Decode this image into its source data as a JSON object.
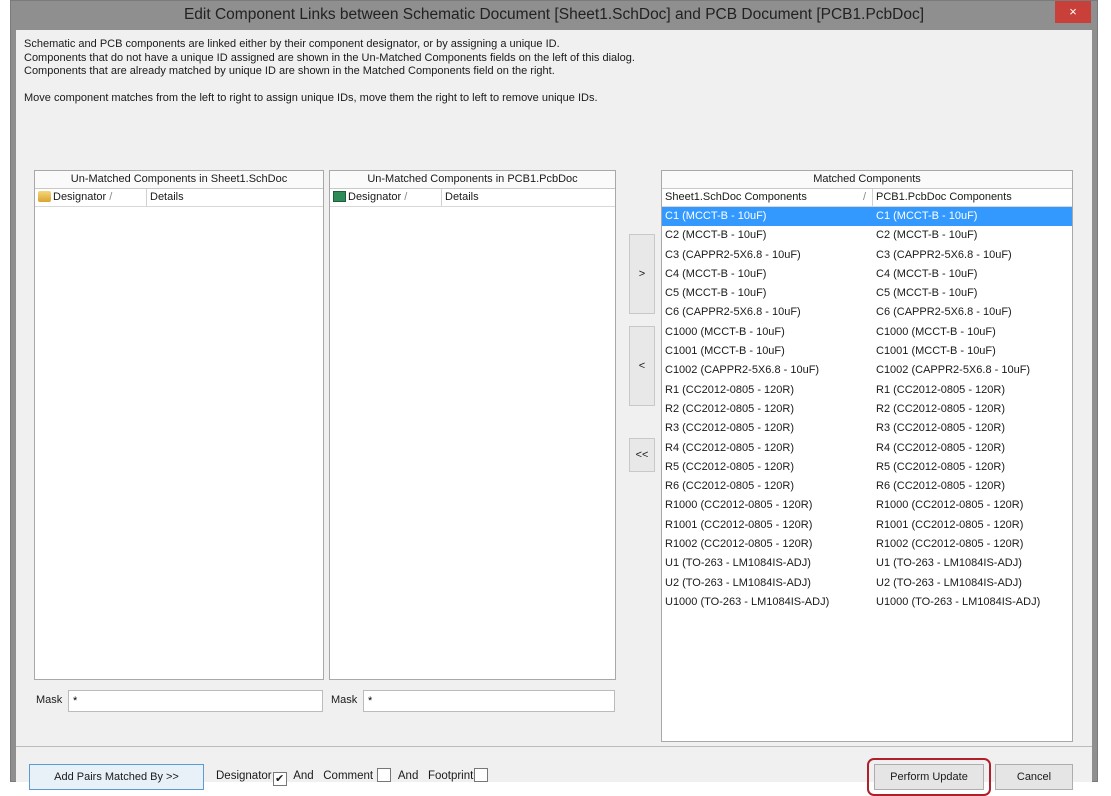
{
  "title": "Edit Component Links between Schematic Document [Sheet1.SchDoc] and PCB Document [PCB1.PcbDoc]",
  "close_label": "×",
  "intro": [
    "Schematic and PCB components are linked either by their component designator, or by assigning a unique ID.",
    "Components that do not have a unique ID assigned are shown in the Un-Matched Components fields on the left of this dialog.",
    "Components that are already matched by unique ID are shown in the Matched Components field on the right.",
    "Move component matches from the left to right to assign unique IDs, move them the right to left to remove unique IDs."
  ],
  "left_panel": {
    "title": "Un-Matched Components in Sheet1.SchDoc",
    "col1": "Designator",
    "sort": "/",
    "col2": "Details",
    "mask_label": "Mask",
    "mask_value": "*"
  },
  "mid_panel": {
    "title": "Un-Matched Components in PCB1.PcbDoc",
    "col1": "Designator",
    "sort": "/",
    "col2": "Details",
    "mask_label": "Mask",
    "mask_value": "*"
  },
  "move_buttons": {
    "right": ">",
    "left": "<",
    "all_left": "<<"
  },
  "matched": {
    "title": "Matched Components",
    "col1": "Sheet1.SchDoc Components",
    "sort": "/",
    "col2": "PCB1.PcbDoc Components",
    "rows": [
      [
        "C1 (MCCT-B - 10uF)",
        "C1 (MCCT-B - 10uF)"
      ],
      [
        "C2 (MCCT-B - 10uF)",
        "C2 (MCCT-B - 10uF)"
      ],
      [
        "C3 (CAPPR2-5X6.8 - 10uF)",
        "C3 (CAPPR2-5X6.8 - 10uF)"
      ],
      [
        "C4 (MCCT-B - 10uF)",
        "C4 (MCCT-B - 10uF)"
      ],
      [
        "C5 (MCCT-B - 10uF)",
        "C5 (MCCT-B - 10uF)"
      ],
      [
        "C6 (CAPPR2-5X6.8 - 10uF)",
        "C6 (CAPPR2-5X6.8 - 10uF)"
      ],
      [
        "C1000 (MCCT-B - 10uF)",
        "C1000 (MCCT-B - 10uF)"
      ],
      [
        "C1001 (MCCT-B - 10uF)",
        "C1001 (MCCT-B - 10uF)"
      ],
      [
        "C1002 (CAPPR2-5X6.8 - 10uF)",
        "C1002 (CAPPR2-5X6.8 - 10uF)"
      ],
      [
        "R1 (CC2012-0805 - 120R)",
        "R1 (CC2012-0805 - 120R)"
      ],
      [
        "R2 (CC2012-0805 - 120R)",
        "R2 (CC2012-0805 - 120R)"
      ],
      [
        "R3 (CC2012-0805 - 120R)",
        "R3 (CC2012-0805 - 120R)"
      ],
      [
        "R4 (CC2012-0805 - 120R)",
        "R4 (CC2012-0805 - 120R)"
      ],
      [
        "R5 (CC2012-0805 - 120R)",
        "R5 (CC2012-0805 - 120R)"
      ],
      [
        "R6 (CC2012-0805 - 120R)",
        "R6 (CC2012-0805 - 120R)"
      ],
      [
        "R1000 (CC2012-0805 - 120R)",
        "R1000 (CC2012-0805 - 120R)"
      ],
      [
        "R1001 (CC2012-0805 - 120R)",
        "R1001 (CC2012-0805 - 120R)"
      ],
      [
        "R1002 (CC2012-0805 - 120R)",
        "R1002 (CC2012-0805 - 120R)"
      ],
      [
        "U1 (TO-263 - LM1084IS-ADJ)",
        "U1 (TO-263 - LM1084IS-ADJ)"
      ],
      [
        "U2 (TO-263 - LM1084IS-ADJ)",
        "U2 (TO-263 - LM1084IS-ADJ)"
      ],
      [
        "U1000 (TO-263 - LM1084IS-ADJ)",
        "U1000 (TO-263 - LM1084IS-ADJ)"
      ]
    ]
  },
  "footer": {
    "add_pairs": "Add Pairs Matched By >>",
    "designator": "Designator",
    "designator_checked": true,
    "and1": "And",
    "comment": "Comment",
    "comment_checked": false,
    "and2": "And",
    "footprint": "Footprint",
    "footprint_checked": false,
    "perform_update": "Perform Update",
    "cancel": "Cancel"
  }
}
